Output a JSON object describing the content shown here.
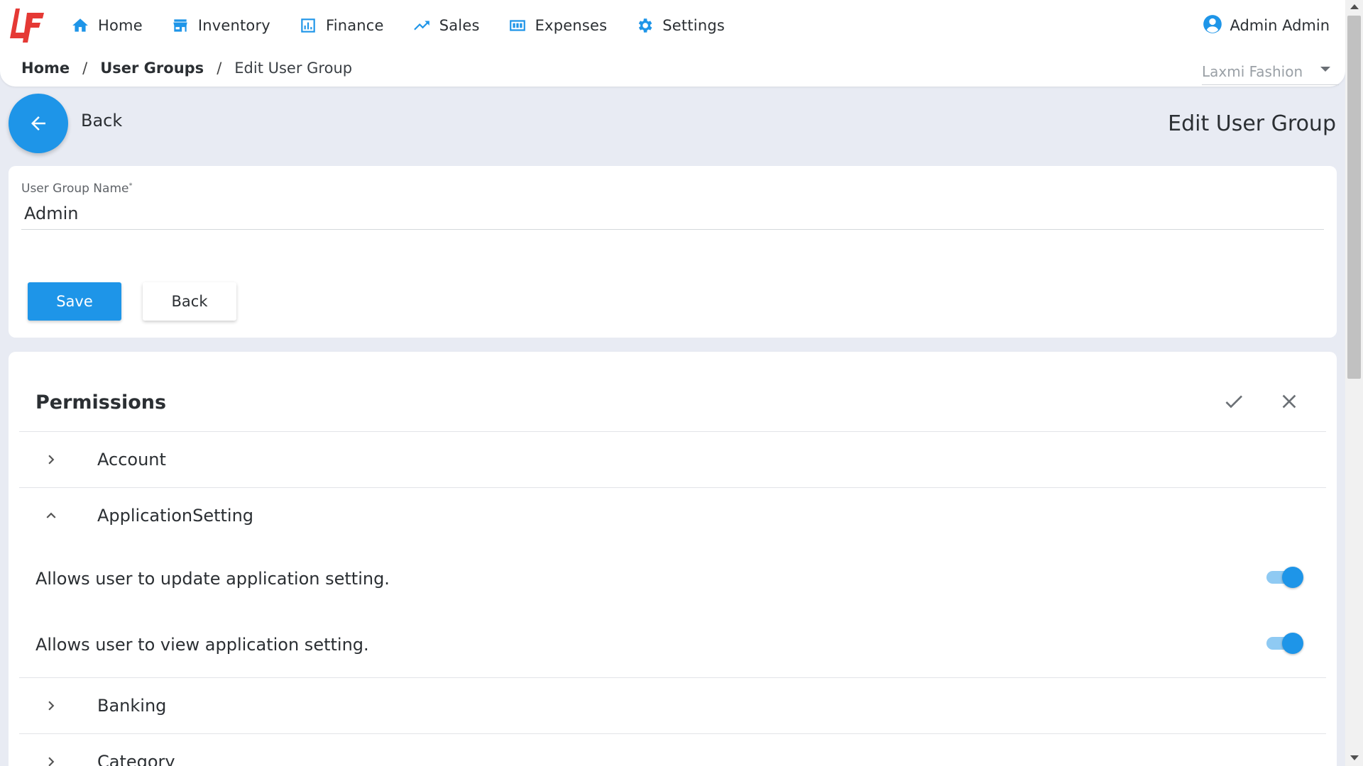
{
  "header": {
    "nav": [
      {
        "label": "Home",
        "icon": "home-icon"
      },
      {
        "label": "Inventory",
        "icon": "store-icon"
      },
      {
        "label": "Finance",
        "icon": "chart-icon"
      },
      {
        "label": "Sales",
        "icon": "trend-icon"
      },
      {
        "label": "Expenses",
        "icon": "expenses-icon"
      },
      {
        "label": "Settings",
        "icon": "gear-icon"
      }
    ],
    "user_name": "Admin Admin",
    "company": "Laxmi Fashion"
  },
  "breadcrumb": {
    "home": "Home",
    "sep": "/",
    "groups": "User Groups",
    "current": "Edit User Group"
  },
  "page": {
    "back_label": "Back",
    "title": "Edit User Group"
  },
  "form": {
    "name_label": "User Group Name",
    "required_mark": "*",
    "name_value": "Admin",
    "save_label": "Save",
    "back_label": "Back"
  },
  "permissions": {
    "title": "Permissions",
    "groups": [
      {
        "label": "Account",
        "expanded": false
      },
      {
        "label": "ApplicationSetting",
        "expanded": true
      },
      {
        "label": "Banking",
        "expanded": false
      },
      {
        "label": "Category",
        "expanded": false
      }
    ],
    "items": [
      {
        "label": "Allows user to update application setting.",
        "enabled": true
      },
      {
        "label": "Allows user to view application setting.",
        "enabled": true
      }
    ]
  },
  "colors": {
    "accent": "#1e95e8",
    "brand": "#e53935",
    "background": "#e8ebf3"
  }
}
